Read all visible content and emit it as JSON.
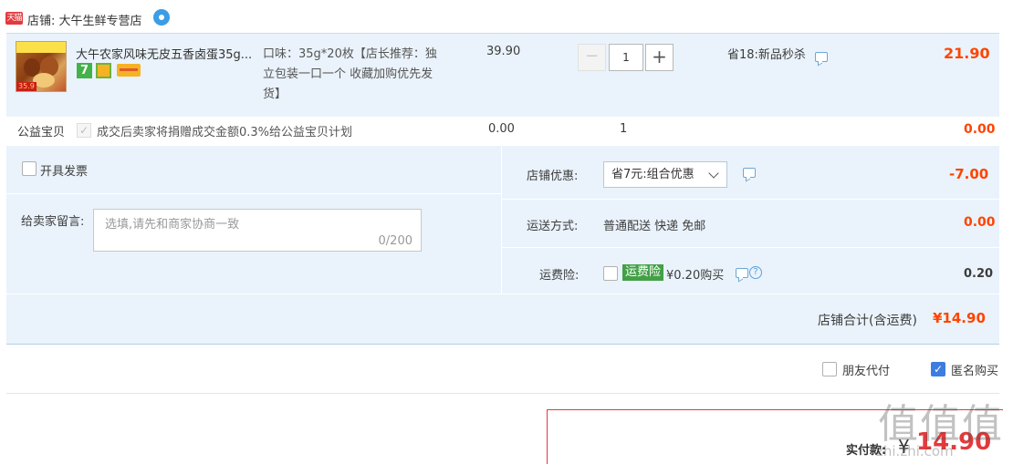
{
  "shop": {
    "badge": "天猫",
    "label": "店铺: 大午生鲜专营店",
    "chat_icon": "wangwang-icon"
  },
  "item": {
    "thumb_tag": "35.9",
    "title": "大午农家风味无皮五香卤蛋35g...",
    "service_icons": [
      "7-day-return-icon",
      "guarantee-icon",
      "card-icon"
    ],
    "service_7": "7",
    "sku": "口味：35g*20枚【店长推荐：独立包装一口一个 收藏加购优先发货】",
    "price": "39.90",
    "quantity": "1",
    "minus": "−",
    "plus": "+",
    "promo": "省18:新品秒杀",
    "total": "21.90"
  },
  "charity": {
    "label": "公益宝贝",
    "text": "成交后卖家将捐赠成交金额0.3%给公益宝贝计划",
    "amount": "0.00",
    "quantity": "1",
    "total": "0.00"
  },
  "options": {
    "invoice_label": "开具发票",
    "message_label": "给卖家留言:",
    "message_placeholder": "选填,请先和商家协商一致",
    "message_count": "0/200",
    "coupon_label": "店铺优惠:",
    "coupon_value": "省7元:组合优惠",
    "coupon_amount": "-7.00",
    "shipping_label": "运送方式:",
    "shipping_value": "普通配送 快递 免邮",
    "shipping_amount": "0.00",
    "insurance_label": "运费险:",
    "insurance_tag": "运费险",
    "insurance_price": "¥0.20购买",
    "insurance_help": "?",
    "insurance_amount": "0.20",
    "subtotal_label": "店铺合计(含运费)",
    "subtotal_amount": "¥14.90"
  },
  "bottom": {
    "friend_pay": "朋友代付",
    "anonymous": "匿名购买",
    "pay_label": "实付款:",
    "pay_yen": "¥",
    "pay_amount": "14.90"
  },
  "watermark": {
    "text": "值值值",
    "sub": "zhi.zhi.com"
  },
  "colors": {
    "accent": "#ff4400",
    "row_bg": "#eaf3fb",
    "checkbox_checked": "#3d7de0",
    "insurance_tag": "#43a047"
  }
}
